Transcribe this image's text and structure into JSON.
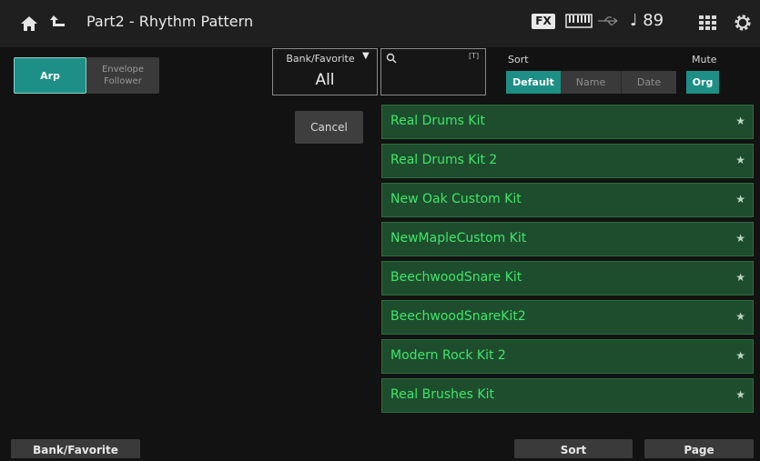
{
  "header": {
    "title": "Part2 - Rhythm Pattern",
    "fx_label": "FX",
    "tempo": "♩ 89",
    "icons": [
      "home-icon",
      "back-icon",
      "keyboard-icon",
      "usb-icon",
      "grid-icon",
      "gear-icon"
    ]
  },
  "mode": {
    "arp_label": "Arp",
    "envelope_label_1": "Envelope",
    "envelope_label_2": "Follower"
  },
  "bank": {
    "label": "Bank/Favorite",
    "caret": "▼",
    "value": "All"
  },
  "search": {
    "icon": "search-icon",
    "tag": "[T]"
  },
  "sort": {
    "label": "Sort",
    "options": [
      "Default",
      "Name",
      "Date"
    ],
    "selected": "Default"
  },
  "mute": {
    "label": "Mute",
    "value": "Org"
  },
  "cancel_label": "Cancel",
  "list": {
    "star": "★",
    "items": [
      "Real Drums Kit",
      "Real Drums Kit 2",
      "New Oak Custom Kit",
      "NewMapleCustom Kit",
      "BeechwoodSnare Kit",
      "BeechwoodSnareKit2",
      "Modern Rock Kit 2",
      "Real Brushes Kit"
    ]
  },
  "footer": {
    "bank_label": "Bank/Favorite",
    "sort_label": "Sort",
    "page_label": "Page"
  },
  "colors": {
    "accent": "#1d8f86",
    "list_bg": "#1e4d2d",
    "list_text": "#3ee66a"
  }
}
